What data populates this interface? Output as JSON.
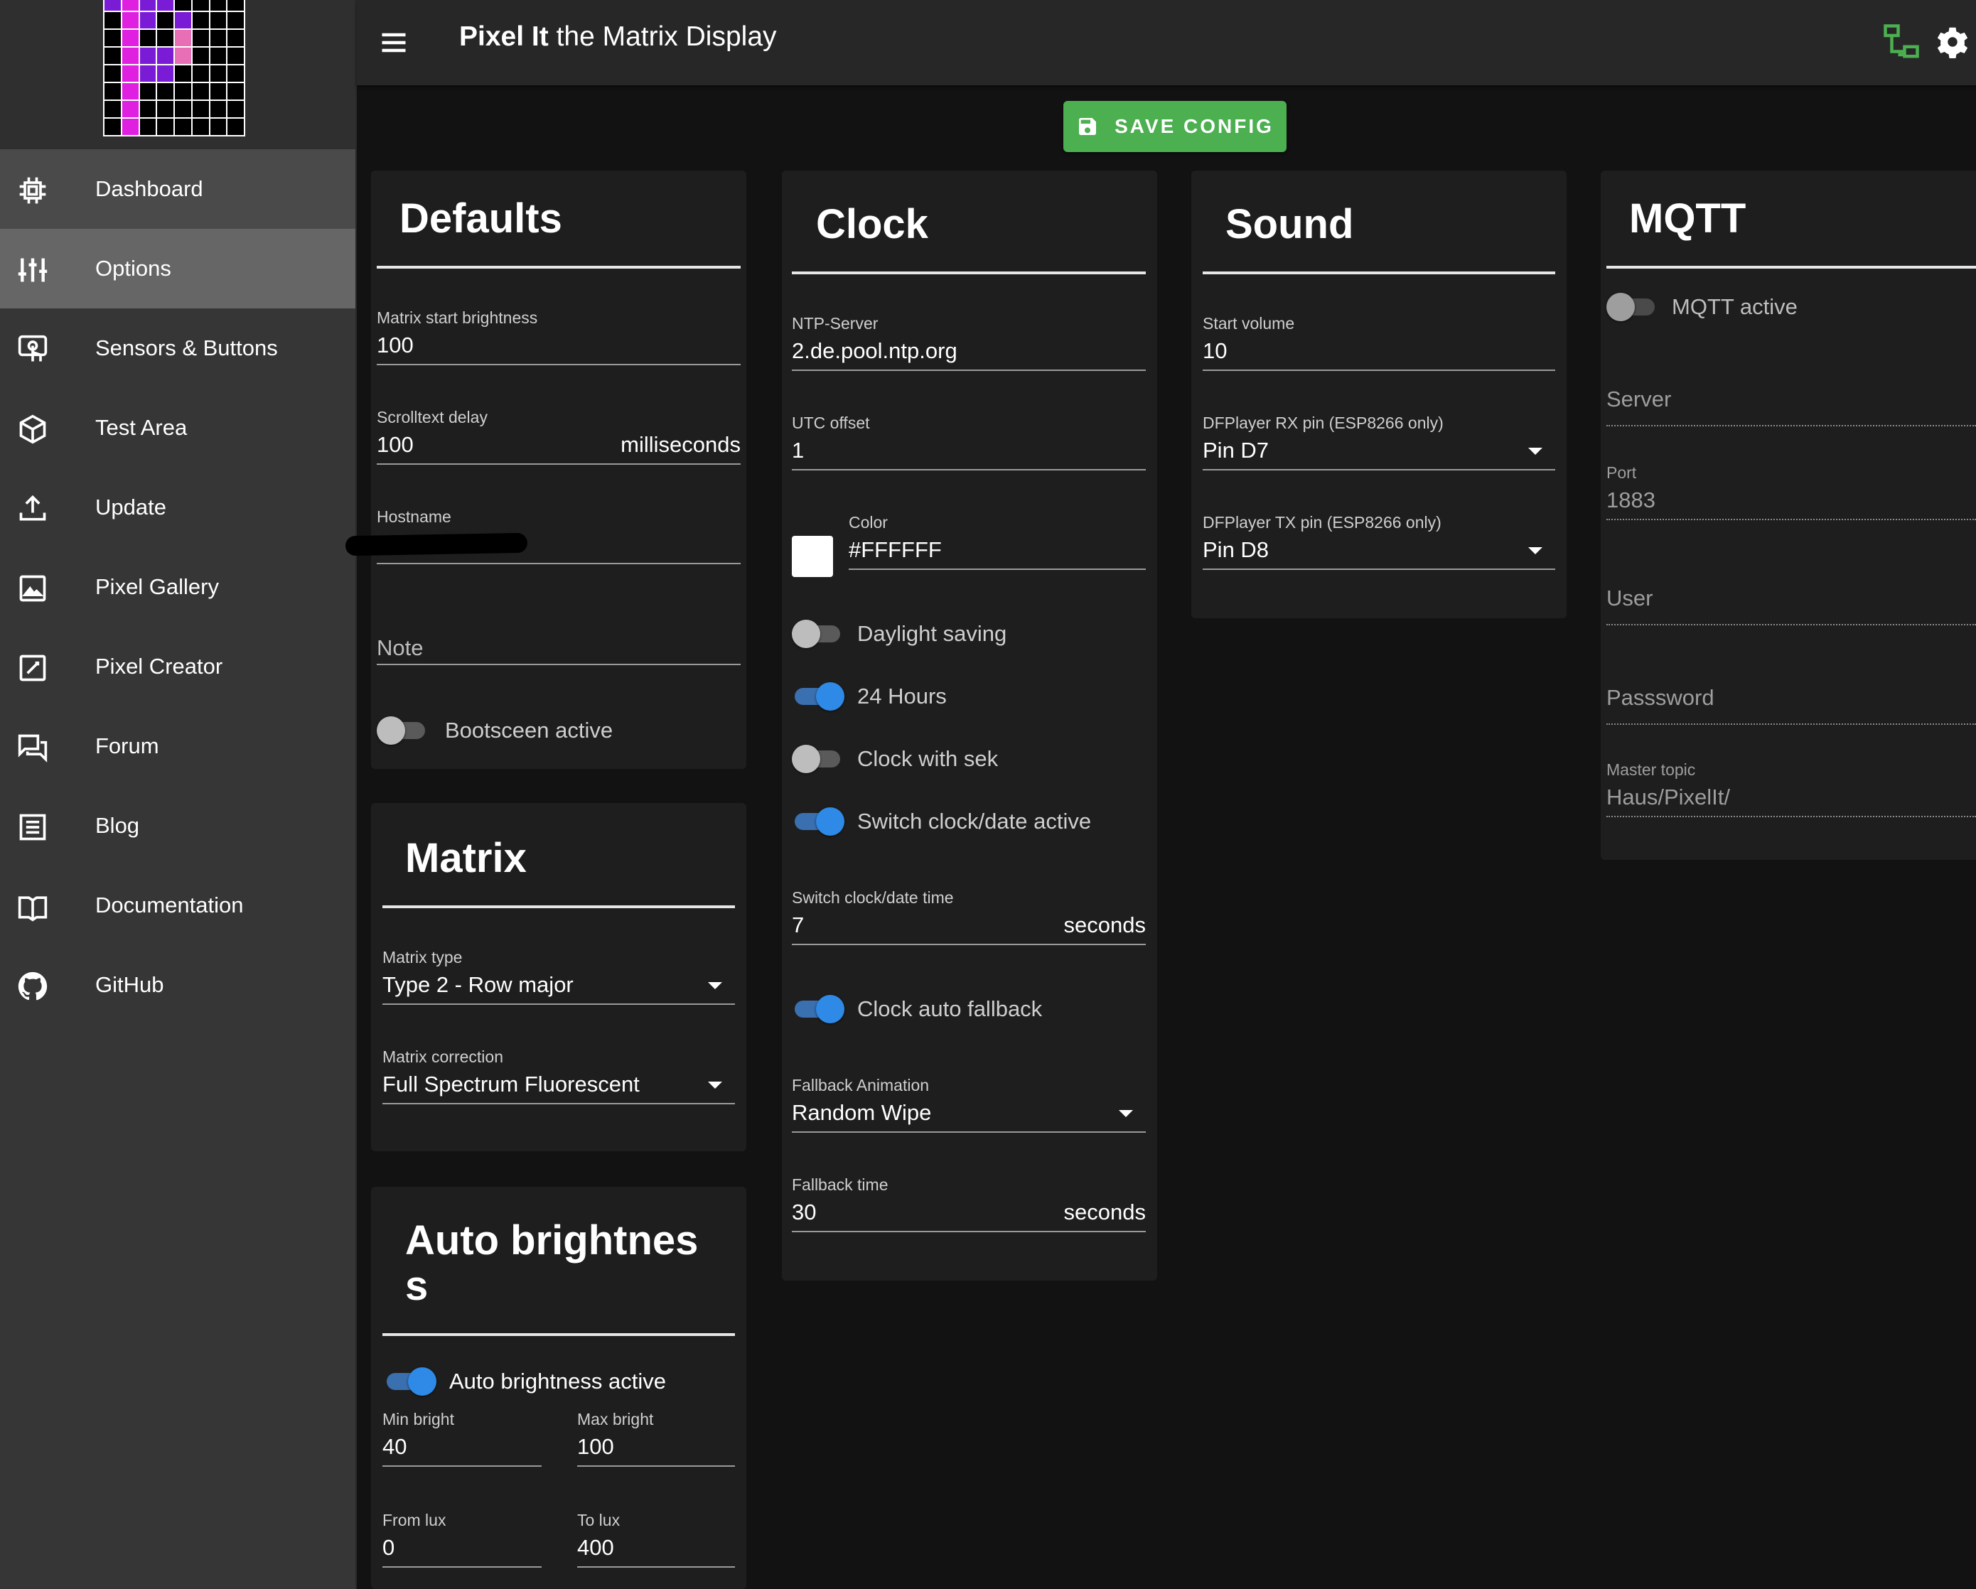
{
  "app": {
    "title_bold": "Pixel It",
    "title_rest": "the Matrix Display"
  },
  "colors": {
    "accent": "#4caf50",
    "toggle_on": "#2e8ae6",
    "sidebar_bg": "#363636",
    "sidebar_active": "#666666",
    "page_bg": "#121212",
    "card_bg": "#1e1e1e",
    "logo_purple": "#7a1bd6",
    "logo_magenta": "#e020e0",
    "logo_pink": "#e86fb6"
  },
  "sidebar": {
    "items": [
      {
        "label": "Dashboard",
        "icon": "chip-icon"
      },
      {
        "label": "Options",
        "icon": "tune-icon"
      },
      {
        "label": "Sensors & Buttons",
        "icon": "touch-icon"
      },
      {
        "label": "Test Area",
        "icon": "cube-icon"
      },
      {
        "label": "Update",
        "icon": "upload-icon"
      },
      {
        "label": "Pixel Gallery",
        "icon": "image-icon"
      },
      {
        "label": "Pixel Creator",
        "icon": "edit-icon"
      },
      {
        "label": "Forum",
        "icon": "forum-icon"
      },
      {
        "label": "Blog",
        "icon": "newspaper-icon"
      },
      {
        "label": "Documentation",
        "icon": "book-icon"
      },
      {
        "label": "GitHub",
        "icon": "github-icon"
      }
    ]
  },
  "toolbar": {
    "save_label": "SAVE CONFIG"
  },
  "defaults": {
    "title": "Defaults",
    "brightness_label": "Matrix start brightness",
    "brightness_value": "100",
    "scroll_label": "Scrolltext delay",
    "scroll_value": "100",
    "scroll_suffix": "milliseconds",
    "hostname_label": "Hostname",
    "note_placeholder": "Note",
    "bootscreen_label": "Bootsceen active"
  },
  "matrix": {
    "title": "Matrix",
    "type_label": "Matrix type",
    "type_value": "Type 2 - Row major",
    "correction_label": "Matrix correction",
    "correction_value": "Full Spectrum Fluorescent"
  },
  "autobright": {
    "title_line1": "Auto brightnes",
    "title_line2": "s",
    "active_label": "Auto brightness active",
    "min_label": "Min bright",
    "min_value": "40",
    "max_label": "Max bright",
    "max_value": "100",
    "from_label": "From lux",
    "from_value": "0",
    "to_label": "To lux",
    "to_value": "400"
  },
  "clock": {
    "title": "Clock",
    "ntp_label": "NTP-Server",
    "ntp_value": "2.de.pool.ntp.org",
    "utc_label": "UTC offset",
    "utc_value": "1",
    "color_label": "Color",
    "color_value": "#FFFFFF",
    "daylight_label": "Daylight saving",
    "hours24_label": "24 Hours",
    "withsek_label": "Clock with sek",
    "switch_label": "Switch clock/date active",
    "switch_time_label": "Switch clock/date time",
    "switch_time_value": "7",
    "switch_time_suffix": "seconds",
    "fallback_label": "Clock auto fallback",
    "fallback_anim_label": "Fallback Animation",
    "fallback_anim_value": "Random Wipe",
    "fallback_time_label": "Fallback time",
    "fallback_time_value": "30",
    "fallback_time_suffix": "seconds"
  },
  "sound": {
    "title": "Sound",
    "volume_label": "Start volume",
    "volume_value": "10",
    "rx_label": "DFPlayer RX pin (ESP8266 only)",
    "rx_value": "Pin D7",
    "tx_label": "DFPlayer TX pin (ESP8266 only)",
    "tx_value": "Pin D8"
  },
  "mqtt": {
    "title": "MQTT",
    "active_label": "MQTT active",
    "server_placeholder": "Server",
    "port_label": "Port",
    "port_value": "1883",
    "user_placeholder": "User",
    "password_placeholder": "Passsword",
    "topic_label": "Master topic",
    "topic_value": "Haus/PixelIt/"
  }
}
